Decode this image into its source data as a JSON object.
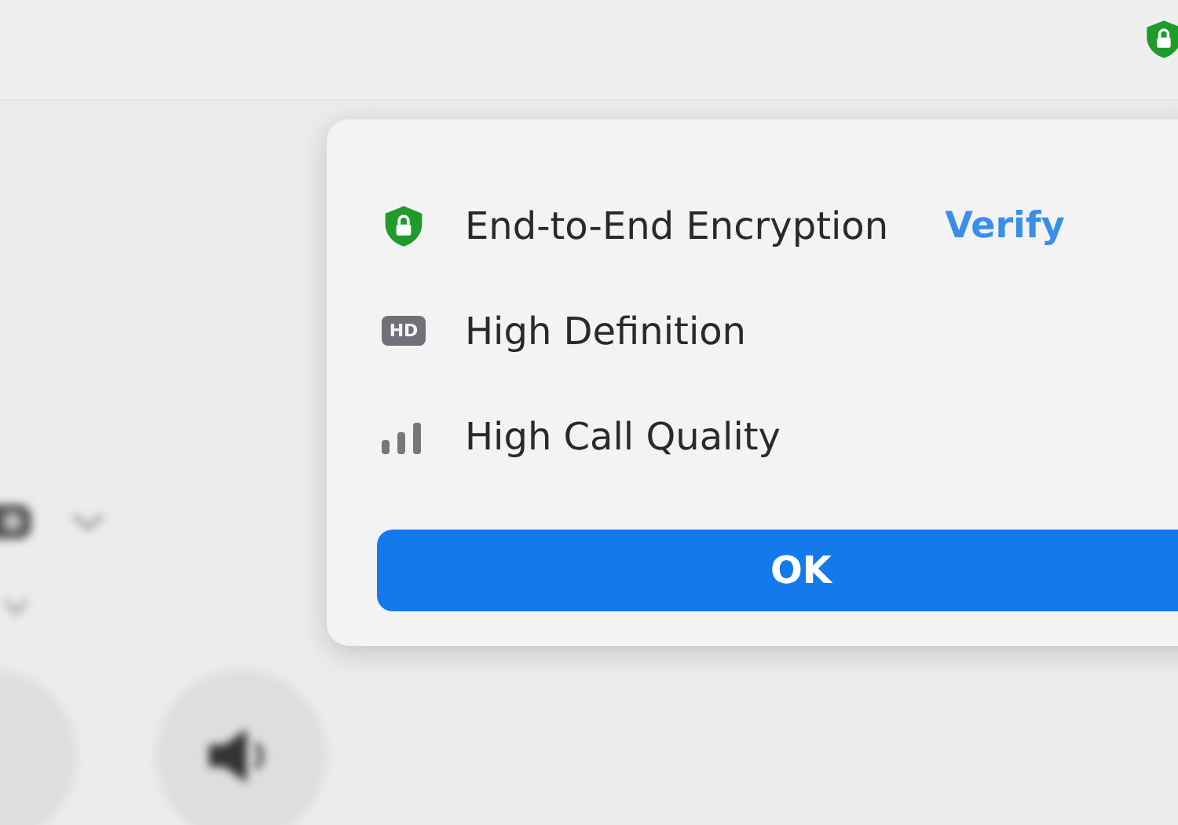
{
  "popup": {
    "rows": [
      {
        "kind": "encryption",
        "label": "End-to-End Encryption",
        "action": "Verify"
      },
      {
        "kind": "hd",
        "badge": "HD",
        "label": "High Definition"
      },
      {
        "kind": "signal",
        "label": "High Call Quality"
      }
    ],
    "button": "OK"
  }
}
